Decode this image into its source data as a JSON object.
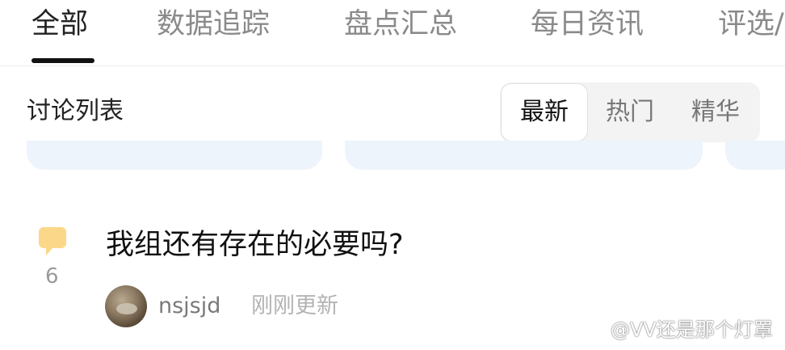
{
  "tabs": [
    {
      "label": "全部",
      "active": true
    },
    {
      "label": "数据追踪",
      "active": false
    },
    {
      "label": "盘点汇总",
      "active": false
    },
    {
      "label": "每日资讯",
      "active": false
    },
    {
      "label": "评选/",
      "active": false
    }
  ],
  "section": {
    "title": "讨论列表",
    "sort_options": [
      {
        "label": "最新",
        "active": true
      },
      {
        "label": "热门",
        "active": false
      },
      {
        "label": "精华",
        "active": false
      }
    ]
  },
  "post": {
    "title": "我组还有存在的必要吗?",
    "comment_count": "6",
    "author": "nsjsjd",
    "updated": "刚刚更新"
  },
  "watermark": "@VV还是那个灯罩",
  "colors": {
    "accent": "#111111",
    "comment_icon": "#fbd889",
    "card_bg": "#eef4fc"
  }
}
